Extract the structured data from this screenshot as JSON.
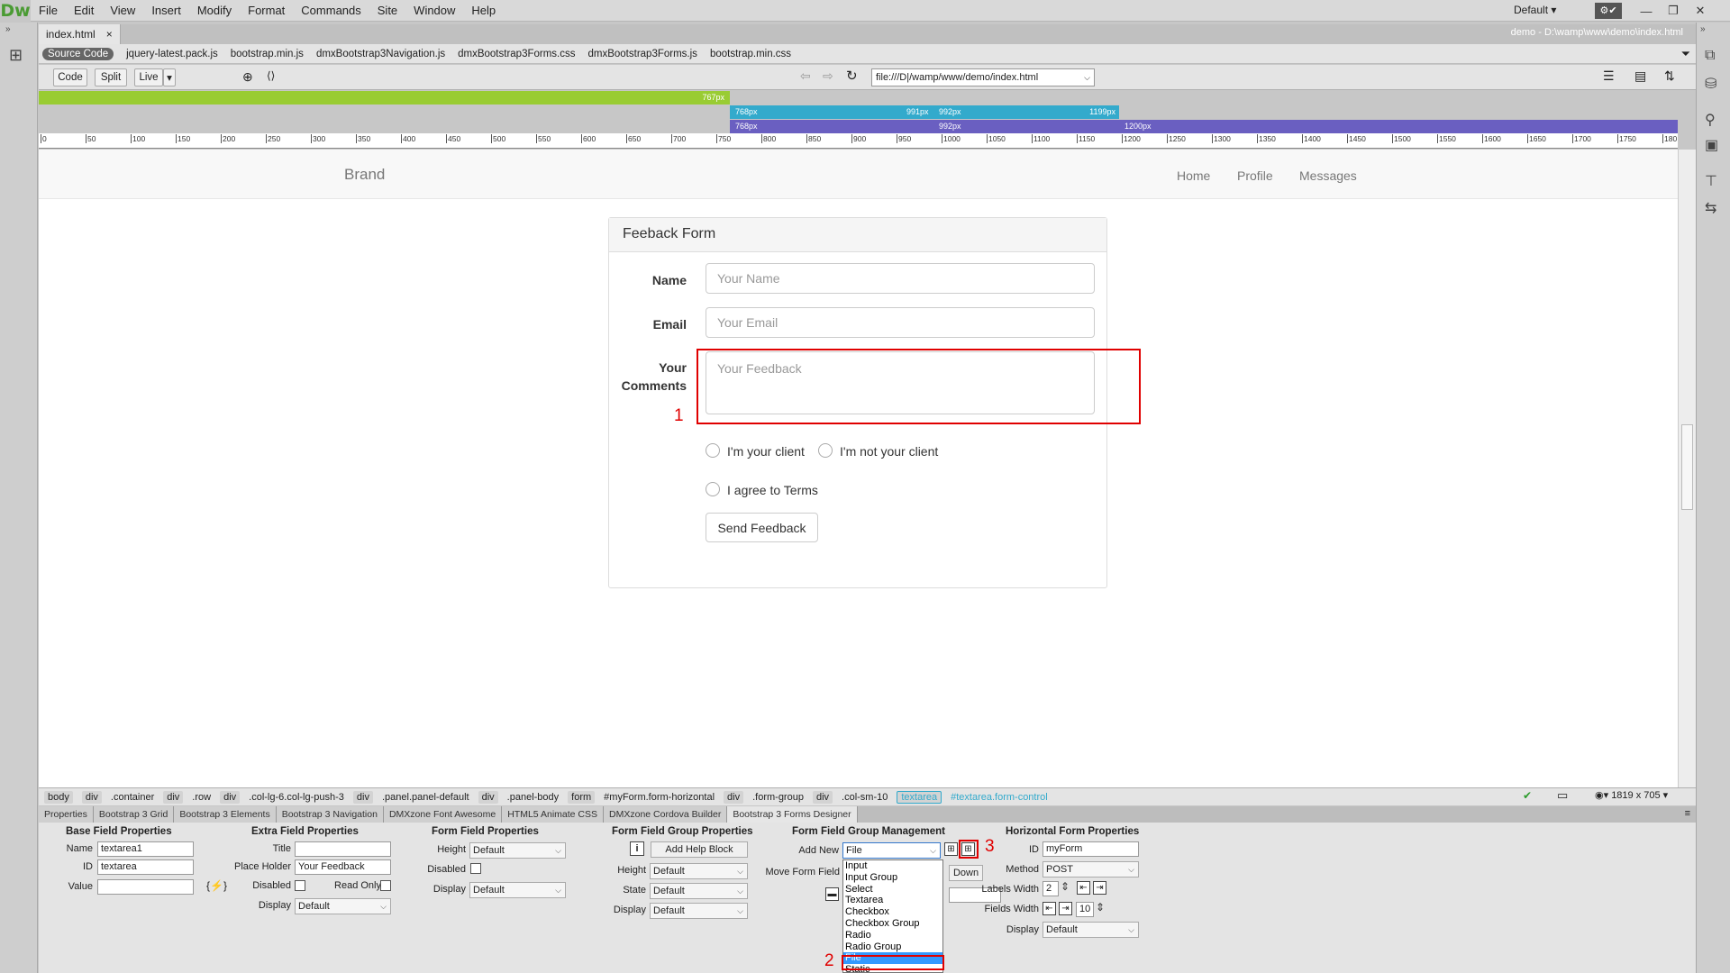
{
  "app": {
    "logo": "Dw",
    "workspace": "Default",
    "icon_names": [
      "sync-icon",
      "minimize-icon",
      "restore-icon",
      "close-icon"
    ]
  },
  "menu": [
    "File",
    "Edit",
    "View",
    "Insert",
    "Modify",
    "Format",
    "Commands",
    "Site",
    "Window",
    "Help"
  ],
  "doc_tab": {
    "label": "index.html",
    "close": "×",
    "path": "demo - D:\\wamp\\www\\demo\\index.html"
  },
  "related_files": [
    "Source Code",
    "jquery-latest.pack.js",
    "bootstrap.min.js",
    "dmxBootstrap3Navigation.js",
    "dmxBootstrap3Forms.css",
    "dmxBootstrap3Forms.js",
    "bootstrap.min.css"
  ],
  "toolbar": {
    "code": "Code",
    "split": "Split",
    "live": "Live",
    "live_arrow": "▾",
    "address": "file:///D|/wamp/www/demo/index.html"
  },
  "media_queries": {
    "mq1": "767px",
    "mq2a": "768px",
    "mq2b": "991px",
    "mq2c": "992px",
    "mq2d": "1199px",
    "mq3a": "768px",
    "mq3b": "992px",
    "mq3c": "1200px"
  },
  "ruler_labels": [
    "0",
    "50",
    "100",
    "150",
    "200",
    "250",
    "300",
    "350",
    "400",
    "450",
    "500",
    "550",
    "600",
    "650",
    "700",
    "750",
    "800",
    "850",
    "900",
    "950",
    "1000",
    "1050",
    "1100",
    "1150",
    "1200",
    "1250",
    "1300",
    "1350",
    "1400",
    "1450",
    "1500",
    "1550",
    "1600",
    "1650",
    "1700",
    "1750",
    "180"
  ],
  "page": {
    "brand": "Brand",
    "nav": [
      "Home",
      "Profile",
      "Messages"
    ],
    "panel_title": "Feeback Form",
    "name_label": "Name",
    "name_placeholder": "Your Name",
    "email_label": "Email",
    "email_placeholder": "Your Email",
    "comments_label_1": "Your",
    "comments_label_2": "Comments",
    "comments_placeholder": "Your Feedback",
    "radio1": "I'm your client",
    "radio2": "I'm not your client",
    "agree": "I agree to Terms",
    "send": "Send Feedback"
  },
  "annotations": {
    "n1": "1",
    "n2": "2",
    "n3": "3"
  },
  "tag_selector": [
    "body",
    "div",
    ".container",
    "div",
    ".row",
    "div",
    ".col-lg-6.col-lg-push-3",
    "div",
    ".panel.panel-default",
    "div",
    ".panel-body",
    "form",
    "#myForm.form-horizontal",
    "div",
    ".form-group",
    "div",
    ".col-sm-10",
    "textarea",
    "#textarea.form-control"
  ],
  "status": {
    "size": "1819 x 705"
  },
  "panel_tabs": [
    "Properties",
    "Bootstrap 3 Grid",
    "Bootstrap 3 Elements",
    "Bootstrap 3 Navigation",
    "DMXzone Font Awesome",
    "HTML5 Animate CSS",
    "DMXzone Cordova Builder",
    "Bootstrap 3 Forms Designer"
  ],
  "props": {
    "base": {
      "title": "Base Field Properties",
      "name_label": "Name",
      "name": "textarea1",
      "id_label": "ID",
      "id": "textarea",
      "value_label": "Value",
      "value": ""
    },
    "extra": {
      "title": "Extra Field Properties",
      "title_label": "Title",
      "placeholder_label": "Place Holder",
      "placeholder": "Your Feedback",
      "disabled_label": "Disabled",
      "readonly_label": "Read Only",
      "display_label": "Display",
      "display": "Default"
    },
    "form_field": {
      "title": "Form Field Properties",
      "height_label": "Height",
      "height": "Default",
      "disabled_label": "Disabled",
      "display_label": "Display",
      "display": "Default"
    },
    "group": {
      "title": "Form Field Group Properties",
      "help_btn": "Add Help Block",
      "height_label": "Height",
      "height": "Default",
      "state_label": "State",
      "state": "Default",
      "display_label": "Display",
      "display": "Default"
    },
    "mgmt": {
      "title": "Form Field Group Management",
      "add_new_label": "Add New",
      "add_new": "File",
      "move_label": "Move Form Field",
      "down": "Down"
    },
    "horizontal": {
      "title": "Horizontal Form Properties",
      "id_label": "ID",
      "id": "myForm",
      "method_label": "Method",
      "method": "POST",
      "labels_width_label": "Labels Width",
      "labels_width": "2",
      "fields_width_label": "Fields Width",
      "fields_width": "10",
      "display_label": "Display",
      "display": "Default"
    }
  },
  "dropdown": [
    "Input",
    "Input Group",
    "Select",
    "Textarea",
    "Checkbox",
    "Checkbox Group",
    "Radio",
    "Radio Group",
    "File",
    "Static"
  ],
  "accent": "#e00000"
}
